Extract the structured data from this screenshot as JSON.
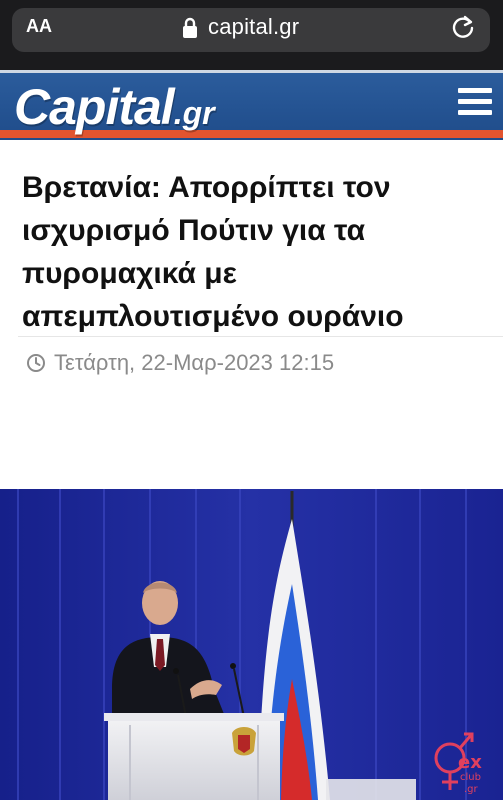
{
  "browser": {
    "aa_label": "AA",
    "url": "capital.gr",
    "icons": [
      "lock-icon",
      "reload-icon"
    ]
  },
  "site": {
    "logo_main": "Capital",
    "logo_suffix": ".gr",
    "menu_icon": "hamburger-menu-icon",
    "colors": {
      "header_blue": "#2b5c9c",
      "accent_orange": "#e2542f"
    }
  },
  "article": {
    "headline": "Βρετανία: Απορρίπτει τον ισχυρισμό Πούτιν για τα πυρομαχικά με απεμπλουτισμένο ουράνιο",
    "date": "Τετάρτη, 22-Μαρ-2023 12:15",
    "date_icon": "clock-icon"
  },
  "photo": {
    "watermark": "sexclub.gr"
  }
}
